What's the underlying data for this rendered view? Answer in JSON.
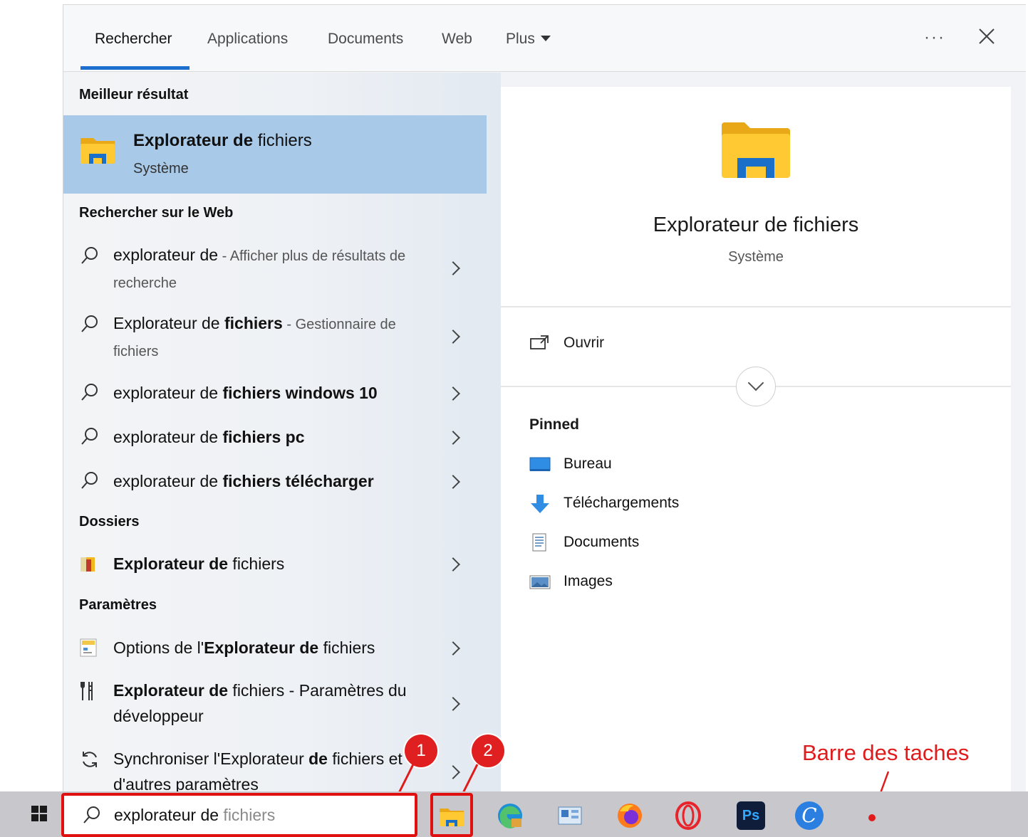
{
  "tabs": {
    "rechercher": "Rechercher",
    "applications": "Applications",
    "documents": "Documents",
    "web": "Web",
    "plus": "Plus",
    "more_dots": "···"
  },
  "left": {
    "best_header": "Meilleur résultat",
    "best": {
      "title_bold": "Explorateur de",
      "title_rest": " fichiers",
      "subtitle": "Système"
    },
    "web_header": "Rechercher sur le Web",
    "web_results": [
      {
        "normal": "explorateur de",
        "light": " - Afficher plus de résultats de recherche"
      },
      {
        "normal": "Explorateur de ",
        "bold": "fichiers",
        "light": " - Gestionnaire de fichiers"
      },
      {
        "normal": "explorateur de ",
        "bold": "fichiers windows 10"
      },
      {
        "normal": "explorateur de ",
        "bold": "fichiers pc"
      },
      {
        "normal": "explorateur de ",
        "bold": "fichiers télécharger"
      }
    ],
    "folders_header": "Dossiers",
    "folder_result": {
      "bold": "Explorateur de",
      "rest": " fichiers"
    },
    "settings_header": "Paramètres",
    "settings_results": [
      {
        "pre": "Options de l'",
        "bold": "Explorateur de",
        "rest": " fichiers"
      },
      {
        "bold": "Explorateur de",
        "rest": " fichiers - Paramètres du développeur"
      },
      {
        "pre": "Synchroniser l'Explorateur ",
        "bold": "de",
        "rest": " fichiers et d'autres paramètres"
      }
    ]
  },
  "right": {
    "title": "Explorateur de fichiers",
    "subtitle": "Système",
    "open_label": "Ouvrir",
    "pinned_header": "Pinned",
    "pinned": [
      {
        "label": "Bureau",
        "icon": "desktop-icon"
      },
      {
        "label": "Téléchargements",
        "icon": "download-arrow-icon"
      },
      {
        "label": "Documents",
        "icon": "document-icon"
      },
      {
        "label": "Images",
        "icon": "pictures-icon"
      }
    ]
  },
  "taskbar": {
    "search_typed": "explorateur de",
    "search_suggest": " fichiers",
    "photoshop_label": "Ps",
    "canva_label": "C"
  },
  "annotations": {
    "badge1": "1",
    "badge2": "2",
    "label": "Barre des taches"
  },
  "colors": {
    "accent": "#1d6fcf",
    "selection": "#a8c9e8",
    "annotation_red": "#e01b1b"
  }
}
